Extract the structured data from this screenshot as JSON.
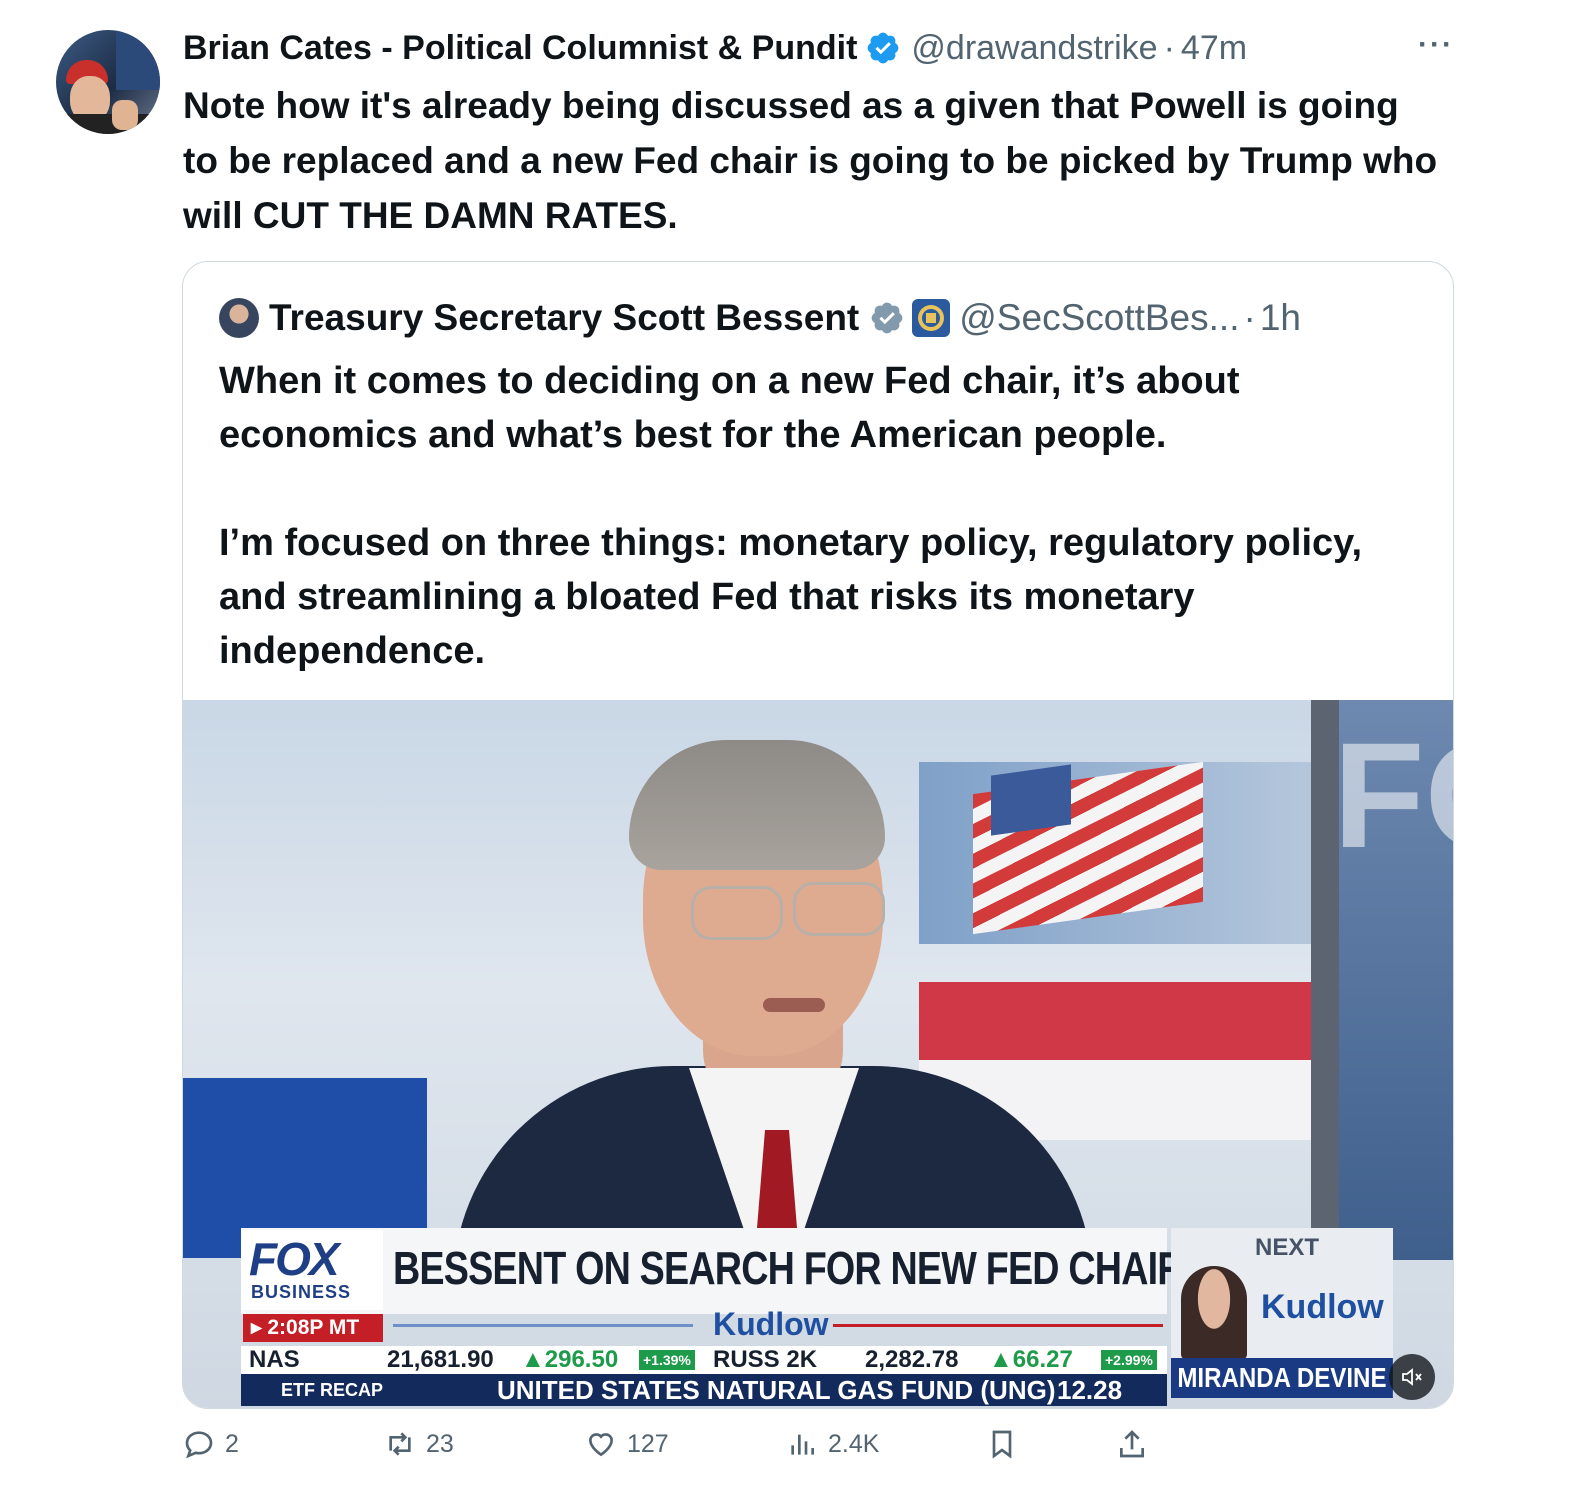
{
  "tweet": {
    "author_name": "Brian Cates - Political Columnist & Pundit",
    "handle": "@drawandstrike",
    "separator": "·",
    "time": "47m",
    "more": "···",
    "text": "Note how it's already being discussed as a given that Powell is going to be replaced and a new Fed chair is going to be picked by Trump who will CUT THE DAMN RATES."
  },
  "quoted": {
    "author_name": "Treasury Secretary Scott Bessent",
    "handle": "@SecScottBes...",
    "separator": "·",
    "time": "1h",
    "paragraph1": "When it comes to deciding on a new Fed chair, it’s about economics and what’s best for the American people.",
    "paragraph2": "I’m focused on three things: monetary policy, regulatory policy, and streamlining a bloated Fed that risks its monetary independence."
  },
  "video": {
    "network": "FOX",
    "network_sub": "BUSINESS",
    "time_chip": "▸ 2:08P MT",
    "headline": "BESSENT ON SEARCH FOR NEW FED CHAIR",
    "show": "Kudlow",
    "next_label": "NEXT",
    "next_show": "Kudlow",
    "guest": "MIRANDA DEVINE",
    "backdrop_text": "FO",
    "ticker1": {
      "nas": "NAS",
      "nas_value": "21,681.90",
      "nas_change": "▲296.50",
      "nas_pct": "+1.39%",
      "russ": "RUSS 2K",
      "russ_value": "2,282.78",
      "russ_change": "▲66.27",
      "russ_pct": "+2.99%"
    },
    "ticker2": {
      "recap": "ETF RECAP",
      "text": "UNITED STATES NATURAL GAS FUND (UNG)",
      "value": "12.28"
    }
  },
  "actions": {
    "replies": "2",
    "reposts": "23",
    "likes": "127",
    "views": "2.4K"
  },
  "colors": {
    "verified_blue": "#1d9bf0",
    "grey_badge": "#829aab",
    "muted_text": "#536471",
    "border": "#cfd9de"
  }
}
